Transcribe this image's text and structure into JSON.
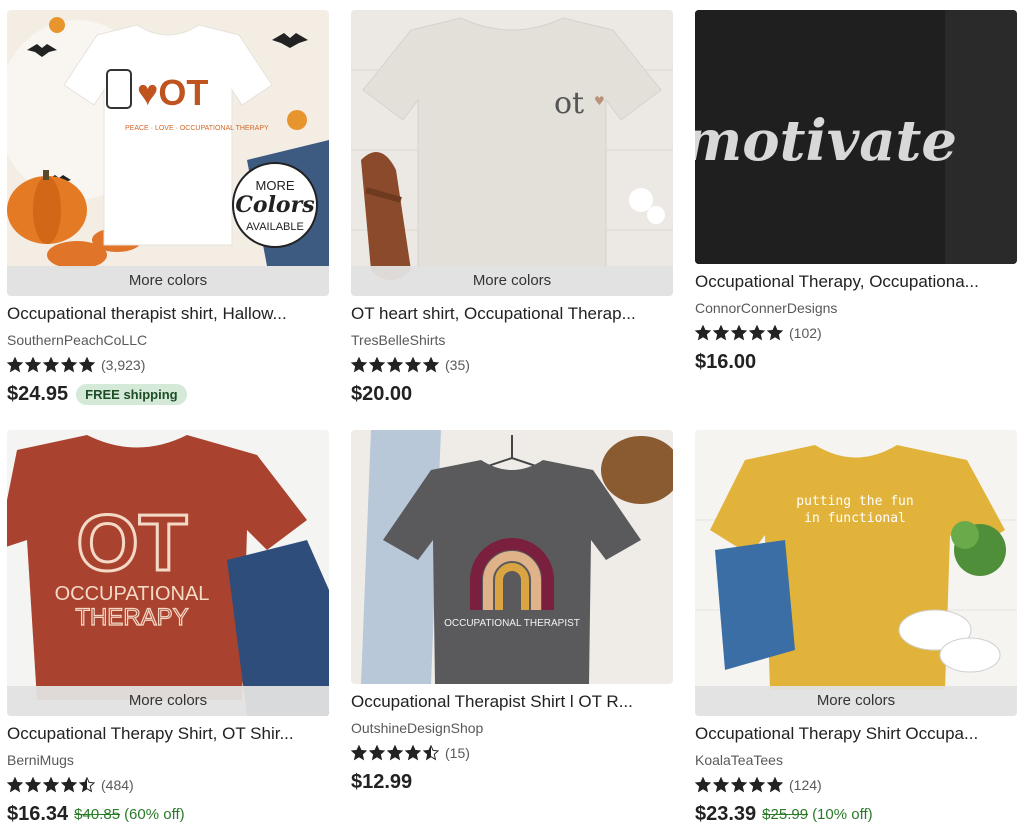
{
  "listings": [
    {
      "more_colors": "More colors",
      "image_text": "MORE Colors AVAILABLE",
      "title": "Occupational therapist shirt, Hallow...",
      "shop": "SouthernPeachCoLLC",
      "rating": 5,
      "reviews": "(3,923)",
      "price": "$24.95",
      "badge": "FREE shipping"
    },
    {
      "more_colors": "More colors",
      "image_text": "ot",
      "title": "OT heart shirt, Occupational Therap...",
      "shop": "TresBelleShirts",
      "rating": 5,
      "reviews": "(35)",
      "price": "$20.00"
    },
    {
      "image_text": "motivate",
      "title": "Occupational Therapy, Occupationa...",
      "shop": "ConnorConnerDesigns",
      "rating": 5,
      "reviews": "(102)",
      "price": "$16.00"
    },
    {
      "more_colors": "More colors",
      "image_text": "OT OCCUPATIONAL THERAPY",
      "title": "Occupational Therapy Shirt, OT Shir...",
      "shop": "BerniMugs",
      "rating": 4.5,
      "reviews": "(484)",
      "price": "$16.34",
      "original_price": "$40.85",
      "discount": "(60% off)"
    },
    {
      "image_text": "OCCUPATIONAL THERAPIST",
      "title": "Occupational Therapist Shirt l OT R...",
      "shop": "OutshineDesignShop",
      "rating": 4.5,
      "reviews": "(15)",
      "price": "$12.99"
    },
    {
      "more_colors": "More colors",
      "image_text": "putting the fun in functional",
      "title": "Occupational Therapy Shirt Occupa...",
      "shop": "KoalaTeaTees",
      "rating": 5,
      "reviews": "(124)",
      "price": "$23.39",
      "original_price": "$25.99",
      "discount": "(10% off)"
    }
  ],
  "colors": {
    "star": "#222222",
    "discount_green": "#2a7a2a",
    "badge_bg": "#d4e9d7"
  },
  "icons": {
    "rating": "star-icon"
  }
}
